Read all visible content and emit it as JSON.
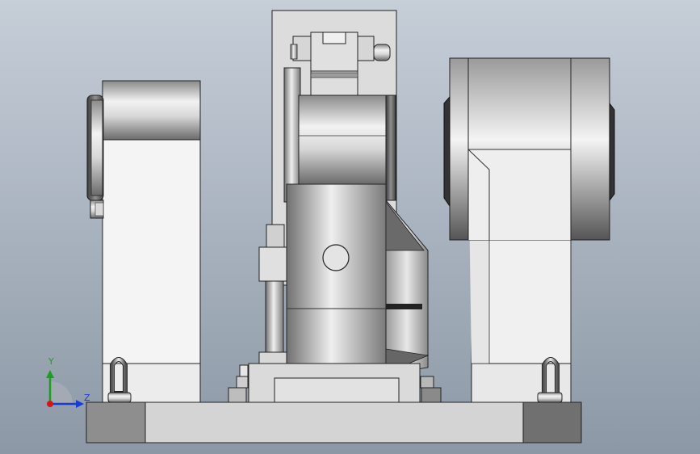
{
  "viewport": {
    "background_top": "#c3ccd6",
    "background_bottom": "#8e99a6"
  },
  "triad": {
    "y_label": "Y",
    "z_label": "Z",
    "y_color": "#1aa01a",
    "z_color": "#1a3ad6",
    "x_color": "#d01818"
  }
}
